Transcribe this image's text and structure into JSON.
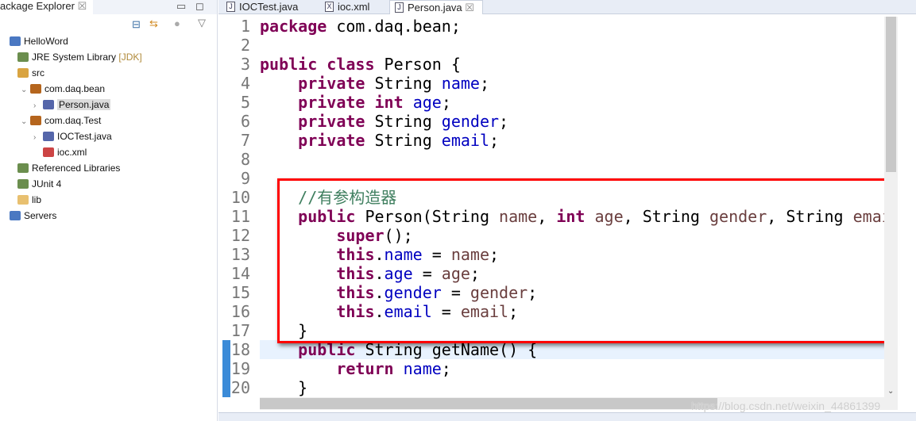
{
  "explorer": {
    "title": "ackage Explorer",
    "items": [
      {
        "label": "HelloWord",
        "icon": "project-icon",
        "indent": 0
      },
      {
        "label": "JRE System Library",
        "deco": "[JDK]",
        "icon": "library-icon",
        "indent": 1
      },
      {
        "label": "src",
        "icon": "source-folder-icon",
        "indent": 1
      },
      {
        "label": "com.daq.bean",
        "icon": "package-icon",
        "indent": 2,
        "twisty": "v"
      },
      {
        "label": "Person.java",
        "icon": "java-file-icon",
        "indent": 3,
        "twisty": ">",
        "selected": true
      },
      {
        "label": "com.daq.Test",
        "icon": "package-icon",
        "indent": 2,
        "twisty": "v"
      },
      {
        "label": "IOCTest.java",
        "icon": "java-file-icon",
        "indent": 3,
        "twisty": ">"
      },
      {
        "label": "ioc.xml",
        "icon": "xml-file-icon",
        "indent": 3
      },
      {
        "label": "Referenced Libraries",
        "icon": "library-icon",
        "indent": 1
      },
      {
        "label": "JUnit 4",
        "icon": "library-icon",
        "indent": 1
      },
      {
        "label": "lib",
        "icon": "folder-icon",
        "indent": 1
      },
      {
        "label": "Servers",
        "icon": "project-icon",
        "indent": 0
      }
    ]
  },
  "editor": {
    "tabs": [
      {
        "label": "IOCTest.java",
        "icon": "J"
      },
      {
        "label": "ioc.xml",
        "icon": "X"
      },
      {
        "label": "Person.java",
        "icon": "J",
        "active": true
      }
    ],
    "lines": [
      "<span class='kw'>package</span> com.daq.bean;",
      "",
      "<span class='kw'>public</span> <span class='kw'>class</span> Person {",
      "    <span class='kw'>private</span> String <span class='fd'>name</span>;",
      "    <span class='kw'>private</span> <span class='kw'>int</span> <span class='fd'>age</span>;",
      "    <span class='kw'>private</span> String <span class='fd'>gender</span>;",
      "    <span class='kw'>private</span> String <span class='fd'>email</span>;",
      "",
      "",
      "    <span class='cm'>//有参构造器</span>",
      "    <span class='kw'>public</span> Person(String <span class='pm'>name</span>, <span class='kw'>int</span> <span class='pm'>age</span>, String <span class='pm'>gender</span>, String <span class='pm'>email</span>) {",
      "        <span class='kw'>super</span>();",
      "        <span class='kw'>this</span>.<span class='fd'>name</span> = <span class='pm'>name</span>;",
      "        <span class='kw'>this</span>.<span class='fd'>age</span> = <span class='pm'>age</span>;",
      "        <span class='kw'>this</span>.<span class='fd'>gender</span> = <span class='pm'>gender</span>;",
      "        <span class='kw'>this</span>.<span class='fd'>email</span> = <span class='pm'>email</span>;",
      "    }",
      "    <span class='kw'>public</span> String getName() {",
      "        <span class='kw'>return</span> <span class='fd'>name</span>;",
      "    }"
    ],
    "current_line": 18
  },
  "watermark": "https://blog.csdn.net/weixin_44861399"
}
